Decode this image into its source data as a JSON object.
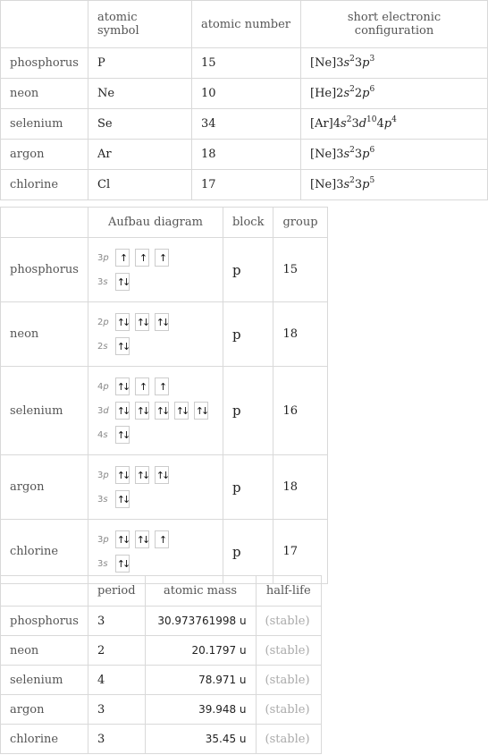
{
  "table1": {
    "headers": [
      "",
      "atomic symbol",
      "atomic number",
      "short electronic configuration"
    ],
    "rows": [
      {
        "element": "phosphorus",
        "symbol": "P",
        "number": "15",
        "config": [
          [
            "[Ne]3",
            ""
          ],
          [
            "s",
            "2"
          ],
          [
            "3",
            ""
          ],
          [
            "p",
            "3"
          ]
        ]
      },
      {
        "element": "neon",
        "symbol": "Ne",
        "number": "10",
        "config": [
          [
            "[He]2",
            ""
          ],
          [
            "s",
            "2"
          ],
          [
            "2",
            ""
          ],
          [
            "p",
            "6"
          ]
        ]
      },
      {
        "element": "selenium",
        "symbol": "Se",
        "number": "34",
        "config": [
          [
            "[Ar]4",
            ""
          ],
          [
            "s",
            "2"
          ],
          [
            "3",
            ""
          ],
          [
            "d",
            "10"
          ],
          [
            "4",
            ""
          ],
          [
            "p",
            "4"
          ]
        ]
      },
      {
        "element": "argon",
        "symbol": "Ar",
        "number": "18",
        "config": [
          [
            "[Ne]3",
            ""
          ],
          [
            "s",
            "2"
          ],
          [
            "3",
            ""
          ],
          [
            "p",
            "6"
          ]
        ]
      },
      {
        "element": "chlorine",
        "symbol": "Cl",
        "number": "17",
        "config": [
          [
            "[Ne]3",
            ""
          ],
          [
            "s",
            "2"
          ],
          [
            "3",
            ""
          ],
          [
            "p",
            "5"
          ]
        ]
      }
    ]
  },
  "table2": {
    "headers": [
      "",
      "Aufbau diagram",
      "block",
      "group"
    ],
    "rows": [
      {
        "element": "phosphorus",
        "block": "p",
        "group": "15",
        "orbitals": [
          {
            "n": "3",
            "l": "p",
            "boxes": [
              "↑",
              "↑",
              "↑"
            ]
          },
          {
            "n": "3",
            "l": "s",
            "boxes": [
              "↑↓"
            ]
          }
        ]
      },
      {
        "element": "neon",
        "block": "p",
        "group": "18",
        "orbitals": [
          {
            "n": "2",
            "l": "p",
            "boxes": [
              "↑↓",
              "↑↓",
              "↑↓"
            ]
          },
          {
            "n": "2",
            "l": "s",
            "boxes": [
              "↑↓"
            ]
          }
        ]
      },
      {
        "element": "selenium",
        "block": "p",
        "group": "16",
        "orbitals": [
          {
            "n": "4",
            "l": "p",
            "boxes": [
              "↑↓",
              "↑",
              "↑"
            ]
          },
          {
            "n": "3",
            "l": "d",
            "boxes": [
              "↑↓",
              "↑↓",
              "↑↓",
              "↑↓",
              "↑↓"
            ]
          },
          {
            "n": "4",
            "l": "s",
            "boxes": [
              "↑↓"
            ]
          }
        ]
      },
      {
        "element": "argon",
        "block": "p",
        "group": "18",
        "orbitals": [
          {
            "n": "3",
            "l": "p",
            "boxes": [
              "↑↓",
              "↑↓",
              "↑↓"
            ]
          },
          {
            "n": "3",
            "l": "s",
            "boxes": [
              "↑↓"
            ]
          }
        ]
      },
      {
        "element": "chlorine",
        "block": "p",
        "group": "17",
        "orbitals": [
          {
            "n": "3",
            "l": "p",
            "boxes": [
              "↑↓",
              "↑↓",
              "↑"
            ]
          },
          {
            "n": "3",
            "l": "s",
            "boxes": [
              "↑↓"
            ]
          }
        ]
      }
    ]
  },
  "table3": {
    "headers": [
      "",
      "period",
      "atomic mass",
      "half-life"
    ],
    "rows": [
      {
        "element": "phosphorus",
        "period": "3",
        "mass": "30.973761998 u",
        "halflife": "(stable)"
      },
      {
        "element": "neon",
        "period": "2",
        "mass": "20.1797 u",
        "halflife": "(stable)"
      },
      {
        "element": "selenium",
        "period": "4",
        "mass": "78.971 u",
        "halflife": "(stable)"
      },
      {
        "element": "argon",
        "period": "3",
        "mass": "39.948 u",
        "halflife": "(stable)"
      },
      {
        "element": "chlorine",
        "period": "3",
        "mass": "35.45 u",
        "halflife": "(stable)"
      }
    ]
  }
}
